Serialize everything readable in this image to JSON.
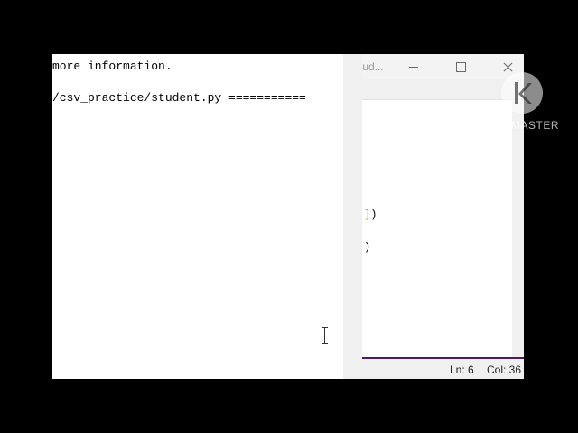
{
  "editor": {
    "title": "tud...",
    "code_fragment_1": {
      "bracket": "]",
      "paren": ")"
    },
    "code_fragment_2": ")",
    "status": {
      "line": "Ln: 6",
      "column": "Col: 36"
    },
    "colors": {
      "bracket": "#e69500",
      "statusbar_accent": "#4b1b6b"
    }
  },
  "shell": {
    "line_1": "more information.",
    "line_2": "/csv_practice/student.py ==========="
  },
  "watermark": {
    "text": "KINEMASTER"
  },
  "icons": [
    "minimize-icon",
    "maximize-icon",
    "close-icon",
    "text-cursor-icon",
    "kinemaster-logo-icon"
  ]
}
